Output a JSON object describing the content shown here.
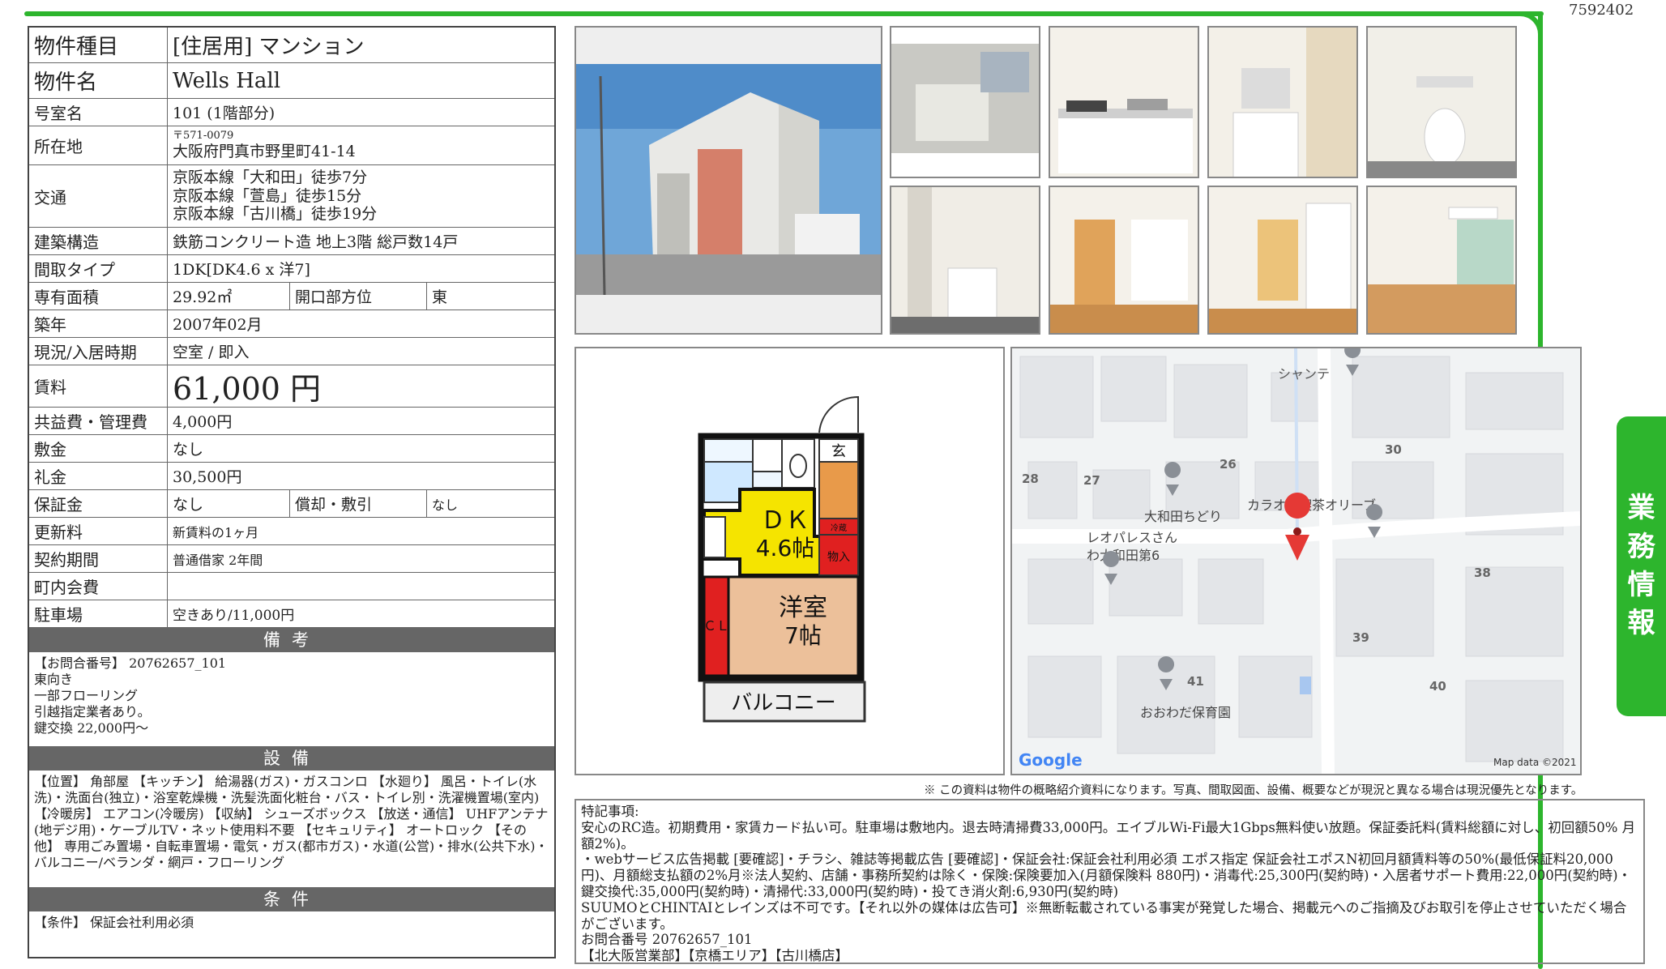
{
  "doc_id": "7592402",
  "side_tab": [
    "業",
    "務",
    "情",
    "報"
  ],
  "property": {
    "type_label": "物件種目",
    "type_value": "[住居用] マンション",
    "name_label": "物件名",
    "name_value": "Wells Hall",
    "room_label": "号室名",
    "room_value": "101 (1階部分)",
    "address_label": "所在地",
    "postal": "〒571-0079",
    "address": "大阪府門真市野里町41-14",
    "traffic_label": "交通",
    "traffic": [
      "京阪本線「大和田」徒歩7分",
      "京阪本線「萱島」徒歩15分",
      "京阪本線「古川橋」徒歩19分"
    ],
    "structure_label": "建築構造",
    "structure_value": "鉄筋コンクリート造 地上3階 総戸数14戸",
    "layout_label": "間取タイプ",
    "layout_value": "1DK[DK4.6 x 洋7]",
    "area_label": "専有面積",
    "area_value": "29.92㎡",
    "direction_label": "開口部方位",
    "direction_value": "東",
    "built_label": "築年",
    "built_value": "2007年02月",
    "status_label": "現況/入居時期",
    "status_value": "空室 / 即入",
    "rent_label": "賃料",
    "rent_value": "61,000 円",
    "fee_label": "共益費・管理費",
    "fee_value": "4,000円",
    "deposit_label": "敷金",
    "deposit_value": "なし",
    "key_money_label": "礼金",
    "key_money_value": "30,500円",
    "guarantee_label": "保証金",
    "guarantee_value": "なし",
    "amort_label": "償却・敷引",
    "amort_value": "なし",
    "renewal_label": "更新料",
    "renewal_value": "新賃料の1ヶ月",
    "contract_label": "契約期間",
    "contract_value": "普通借家 2年間",
    "town_fee_label": "町内会費",
    "town_fee_value": "",
    "parking_label": "駐車場",
    "parking_value": "空きあり/11,000円"
  },
  "remarks": {
    "heading": "備考",
    "text": "【お問合番号】 20762657_101\n東向き\n一部フローリング\n引越指定業者あり。\n鍵交換 22,000円〜"
  },
  "equipment": {
    "heading": "設備",
    "text": "【位置】 角部屋 【キッチン】 給湯器(ガス)・ガスコンロ 【水廻り】 風呂・トイレ(水洗)・洗面台(独立)・浴室乾燥機・洗髪洗面化粧台・バス・トイレ別・洗濯機置場(室内) 【冷暖房】 エアコン(冷暖房) 【収納】 シューズボックス 【放送・通信】 UHFアンテナ(地デジ用)・ケーブルTV・ネット使用料不要 【セキュリティ】 オートロック 【その他】 専用ごみ置場・自転車置場・電気・ガス(都市ガス)・水道(公営)・排水(公共下水)・バルコニー/ベランダ・網戸・フローリング"
  },
  "conditions": {
    "heading": "条件",
    "text": "【条件】 保証会社利用必須"
  },
  "floorplan": {
    "dk_label": "ＤＫ",
    "dk_size": "4.6帖",
    "room_label": "洋室",
    "room_size": "7帖",
    "balcony": "バルコニー",
    "entrance": "玄",
    "closet": "ＣＬ",
    "storage": "物入",
    "fridge": "冷蔵"
  },
  "map": {
    "labels": [
      "シャンテ",
      "大和田ちどり",
      "カラオケ喫茶オリーブ",
      "レオパレスさん",
      "わ大和田第6",
      "おおわだ保育園"
    ],
    "numbers": [
      "28",
      "27",
      "26",
      "30",
      "38",
      "39",
      "40",
      "41"
    ],
    "google": "Google",
    "credit": "Map data ©2021"
  },
  "disclaimer": "※ この資料は物件の概略紹介資料になります。写真、間取図面、設備、概要などが現況と異なる場合は現況優先となります。",
  "notes": [
    "特記事項:",
    "安心のRC造。初期費用・家賃カード払い可。駐車場は敷地内。退去時清掃費33,000円。エイブルWi-Fi最大1Gbps無料使い放題。保証委託料(賃料総額に対し、初回額50% 月額2%)。",
    "・webサービス広告掲載 [要確認]・チラシ、雑誌等掲載広告 [要確認]・保証会社:保証会社利用必須 エポス指定 保証会社エポスN初回月額賃料等の50%(最低保証料20,000円)、月額総支払額の2%月※法人契約、店舗・事務所契約は除く・保険:保険要加入(月額保険料 880円)・消毒代:25,300円(契約時)・入居者サポート費用:22,000円(契約時)・鍵交換代:35,000円(契約時)・清掃代:33,000円(契約時)・投てき消火剤:6,930円(契約時)",
    "SUUMOとCHINTAIとレインズは不可です。【それ以外の媒体は広告可】※無断転載されている事実が発覚した場合、掲載元へのご指摘及びお取引を停止させていただく場合がございます。",
    "お問合番号 20762657_101",
    "【北大阪営業部】【京橋エリア】【古川橋店】"
  ],
  "colors": {
    "accent": "#2db52d",
    "section": "#666666",
    "plan_yellow": "#f5e400",
    "plan_red": "#e02020",
    "plan_orange": "#e89a4a"
  }
}
